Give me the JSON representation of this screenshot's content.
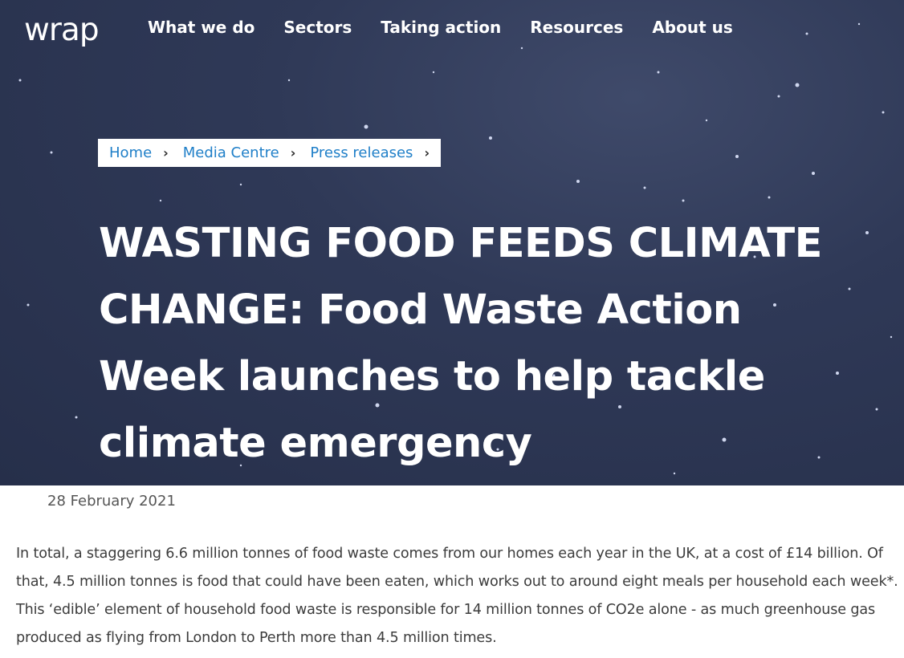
{
  "nav": {
    "logo": "wrap",
    "items": [
      {
        "label": "What we do"
      },
      {
        "label": "Sectors"
      },
      {
        "label": "Taking action"
      },
      {
        "label": "Resources"
      },
      {
        "label": "About us"
      }
    ]
  },
  "breadcrumb": {
    "items": [
      {
        "label": "Home"
      },
      {
        "label": "Media Centre"
      },
      {
        "label": "Press releases"
      }
    ],
    "separator": "›"
  },
  "article": {
    "title": "WASTING FOOD FEEDS CLIMATE CHANGE: Food Waste Action Week launches to help tackle climate emergency",
    "date": "28 February 2021",
    "intro": "In total, a staggering 6.6 million tonnes of food waste comes from our homes each year in the UK, at a cost of £14 billion. Of that, 4.5 million tonnes is food that could have been eaten, which works out to around eight meals per household each week*. This ‘edible’ element of household food waste is responsible for 14 million tonnes of CO2e alone - as much greenhouse gas produced as flying from London to Perth more than 4.5 million times."
  },
  "colors": {
    "hero_background": "#2c3653",
    "link": "#1f7fc8",
    "title_text": "#ffffff",
    "body_text": "#3c3c3c"
  }
}
